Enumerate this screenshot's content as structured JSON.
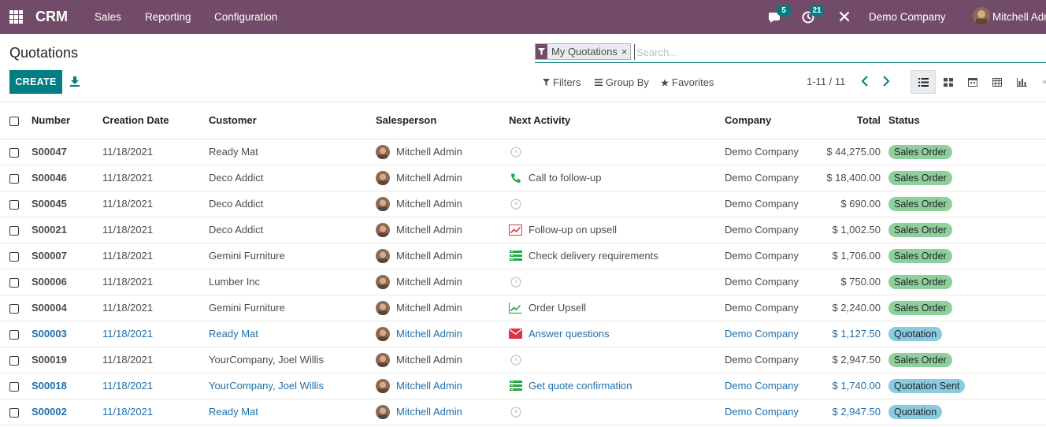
{
  "navbar": {
    "brand": "CRM",
    "menus": [
      "Sales",
      "Reporting",
      "Configuration"
    ],
    "messages_count": "5",
    "activities_count": "21",
    "company": "Demo Company",
    "user": "Mitchell Admin"
  },
  "control_panel": {
    "title": "Quotations",
    "facet": "My Quotations",
    "facet_remove": "×",
    "search_placeholder": "Search...",
    "create_label": "CREATE",
    "filters_label": "Filters",
    "groupby_label": "Group By",
    "favorites_label": "Favorites",
    "pager": "1-11 / 11",
    "views": [
      "list-view-icon",
      "kanban-view-icon",
      "calendar-view-icon",
      "pivot-view-icon",
      "graph-view-icon",
      "activity-view-icon"
    ],
    "active_view": "list-view-icon"
  },
  "table": {
    "headers": {
      "number": "Number",
      "date": "Creation Date",
      "customer": "Customer",
      "salesperson": "Salesperson",
      "activity": "Next Activity",
      "company": "Company",
      "total": "Total",
      "status": "Status"
    },
    "rows": [
      {
        "number": "S00047",
        "date": "11/18/2021",
        "customer": "Ready Mat",
        "salesperson": "Mitchell Admin",
        "activity_icon": "clock-icon",
        "activity": "",
        "company": "Demo Company",
        "total": "$ 44,275.00",
        "status": "Sales Order"
      },
      {
        "number": "S00046",
        "date": "11/18/2021",
        "customer": "Deco Addict",
        "salesperson": "Mitchell Admin",
        "activity_icon": "phone-icon",
        "activity": "Call to follow-up",
        "company": "Demo Company",
        "total": "$ 18,400.00",
        "status": "Sales Order"
      },
      {
        "number": "S00045",
        "date": "11/18/2021",
        "customer": "Deco Addict",
        "salesperson": "Mitchell Admin",
        "activity_icon": "clock-icon",
        "activity": "",
        "company": "Demo Company",
        "total": "$ 690.00",
        "status": "Sales Order"
      },
      {
        "number": "S00021",
        "date": "11/18/2021",
        "customer": "Deco Addict",
        "salesperson": "Mitchell Admin",
        "activity_icon": "upsell-chart-icon",
        "activity": "Follow-up on upsell",
        "company": "Demo Company",
        "total": "$ 1,002.50",
        "status": "Sales Order"
      },
      {
        "number": "S00007",
        "date": "11/18/2021",
        "customer": "Gemini Furniture",
        "salesperson": "Mitchell Admin",
        "activity_icon": "tasks-icon",
        "activity": "Check delivery requirements",
        "company": "Demo Company",
        "total": "$ 1,706.00",
        "status": "Sales Order"
      },
      {
        "number": "S00006",
        "date": "11/18/2021",
        "customer": "Lumber Inc",
        "salesperson": "Mitchell Admin",
        "activity_icon": "clock-icon",
        "activity": "",
        "company": "Demo Company",
        "total": "$ 750.00",
        "status": "Sales Order"
      },
      {
        "number": "S00004",
        "date": "11/18/2021",
        "customer": "Gemini Furniture",
        "salesperson": "Mitchell Admin",
        "activity_icon": "line-chart-icon",
        "activity": "Order Upsell",
        "company": "Demo Company",
        "total": "$ 2,240.00",
        "status": "Sales Order"
      },
      {
        "number": "S00003",
        "date": "11/18/2021",
        "customer": "Ready Mat",
        "salesperson": "Mitchell Admin",
        "activity_icon": "envelope-icon",
        "activity": "Answer questions",
        "company": "Demo Company",
        "total": "$ 1,127.50",
        "status": "Quotation"
      },
      {
        "number": "S00019",
        "date": "11/18/2021",
        "customer": "YourCompany, Joel Willis",
        "salesperson": "Mitchell Admin",
        "activity_icon": "clock-icon",
        "activity": "",
        "company": "Demo Company",
        "total": "$ 2,947.50",
        "status": "Sales Order"
      },
      {
        "number": "S00018",
        "date": "11/18/2021",
        "customer": "YourCompany, Joel Willis",
        "salesperson": "Mitchell Admin",
        "activity_icon": "tasks-icon",
        "activity": "Get quote confirmation",
        "company": "Demo Company",
        "total": "$ 1,740.00",
        "status": "Quotation Sent"
      },
      {
        "number": "S00002",
        "date": "11/18/2021",
        "customer": "Ready Mat",
        "salesperson": "Mitchell Admin",
        "activity_icon": "clock-icon",
        "activity": "",
        "company": "Demo Company",
        "total": "$ 2,947.50",
        "status": "Quotation"
      }
    ]
  },
  "colors": {
    "navbar": "#714b67",
    "primary": "#017e84",
    "link": "#1f6fa8",
    "sales_order_badge": "#8fcf9b",
    "quotation_badge": "#89cbe0"
  }
}
